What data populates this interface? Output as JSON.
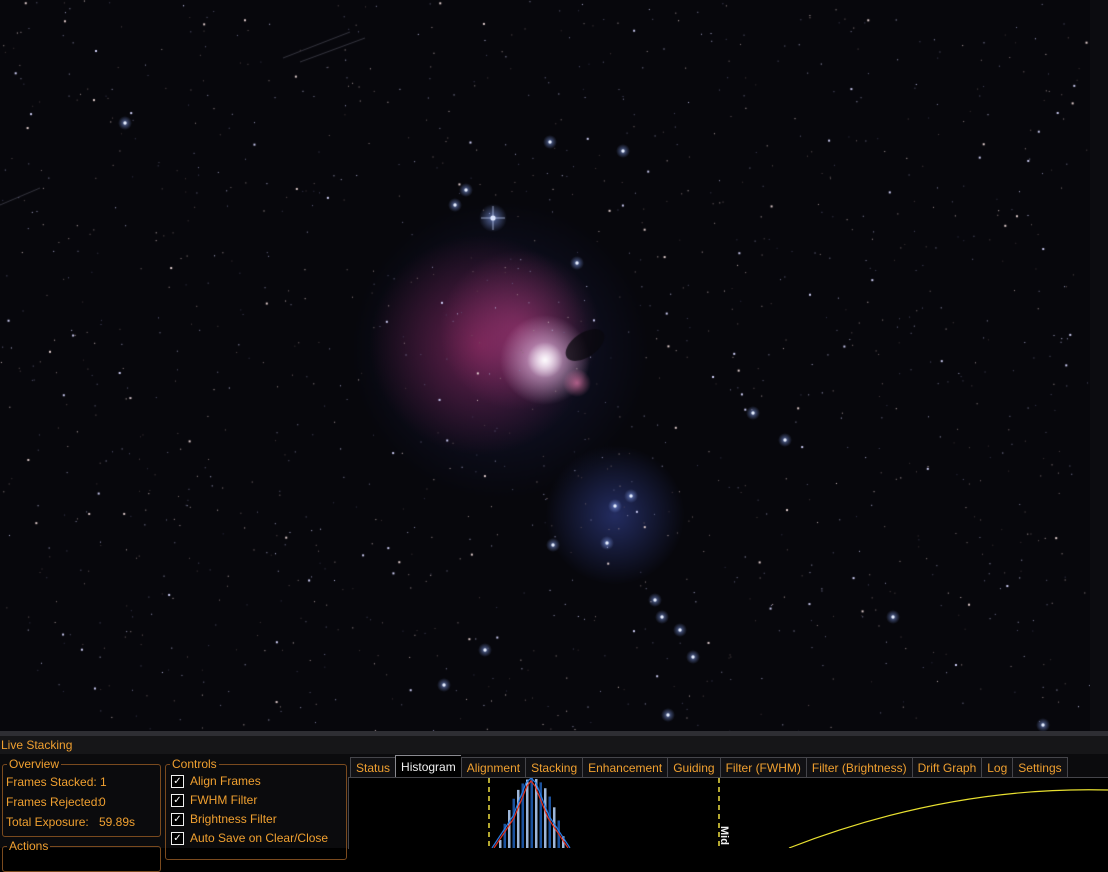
{
  "image_view": {
    "description_icon": "astro-image-canvas",
    "colors": {
      "sky": "#07070c",
      "nebula_core": "#f6eaf6",
      "nebula_outer": "#b0306a",
      "reflection": "#4a60d0"
    }
  },
  "panel": {
    "title": "Live Stacking",
    "overview": {
      "legend": "Overview",
      "frames_stacked_label": "Frames Stacked:",
      "frames_stacked_value": "1",
      "frames_rejected_label": "Frames Rejected:",
      "frames_rejected_value": "0",
      "total_exposure_label": "Total Exposure:",
      "total_exposure_value": "59.89s"
    },
    "actions": {
      "legend": "Actions"
    },
    "controls": {
      "legend": "Controls",
      "items": [
        {
          "label": "Align Frames",
          "checked": true
        },
        {
          "label": "FWHM Filter",
          "checked": true
        },
        {
          "label": "Brightness Filter",
          "checked": true
        },
        {
          "label": "Auto Save on Clear/Close",
          "checked": true
        }
      ]
    },
    "tabs": [
      {
        "label": "Status",
        "active": false
      },
      {
        "label": "Histogram",
        "active": true
      },
      {
        "label": "Alignment",
        "active": false
      },
      {
        "label": "Stacking",
        "active": false
      },
      {
        "label": "Enhancement",
        "active": false
      },
      {
        "label": "Guiding",
        "active": false
      },
      {
        "label": "Filter (FWHM)",
        "active": false
      },
      {
        "label": "Filter (Brightness)",
        "active": false
      },
      {
        "label": "Drift Graph",
        "active": false
      },
      {
        "label": "Log",
        "active": false
      },
      {
        "label": "Settings",
        "active": false
      }
    ],
    "histogram": {
      "mid_label": "Mid",
      "colors": {
        "red": "#e03020",
        "blue": "#2a7be0",
        "curve": "#e8e030",
        "marker": "#f0e040"
      }
    }
  }
}
